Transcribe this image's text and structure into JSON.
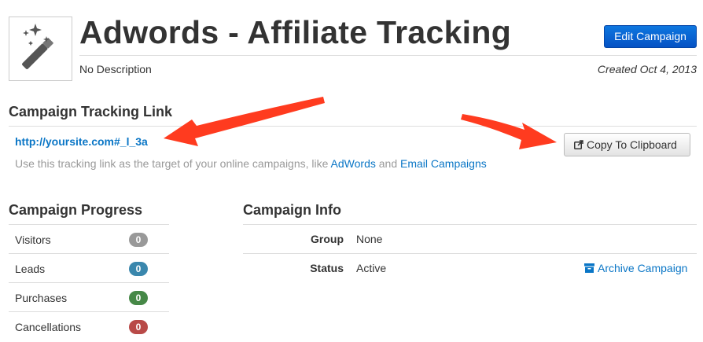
{
  "header": {
    "title": "Adwords - Affiliate Tracking",
    "description": "No Description",
    "created": "Created Oct 4, 2013",
    "edit_button": "Edit Campaign",
    "icon": "magic-wand-icon"
  },
  "tracking": {
    "heading": "Campaign Tracking Link",
    "url": "http://yoursite.com#_l_3a",
    "help_prefix": "Use this tracking link as the target of your online campaigns, like ",
    "help_link1": "AdWords",
    "help_and": " and ",
    "help_link2": "Email Campaigns",
    "copy_button": "Copy To Clipboard",
    "copy_icon": "share-icon"
  },
  "progress": {
    "heading": "Campaign Progress",
    "rows": [
      {
        "label": "Visitors",
        "count": "0",
        "color": "#999999"
      },
      {
        "label": "Leads",
        "count": "0",
        "color": "#3a87ad"
      },
      {
        "label": "Purchases",
        "count": "0",
        "color": "#468847"
      },
      {
        "label": "Cancellations",
        "count": "0",
        "color": "#b94a48"
      }
    ]
  },
  "info": {
    "heading": "Campaign Info",
    "group_label": "Group",
    "group_value": "None",
    "status_label": "Status",
    "status_value": "Active",
    "archive_link": "Archive Campaign",
    "archive_icon": "archive-box-icon"
  },
  "colors": {
    "link": "#0a76c6",
    "primary_button": "#0552c4",
    "annotation_arrow": "#ff3b1f"
  }
}
